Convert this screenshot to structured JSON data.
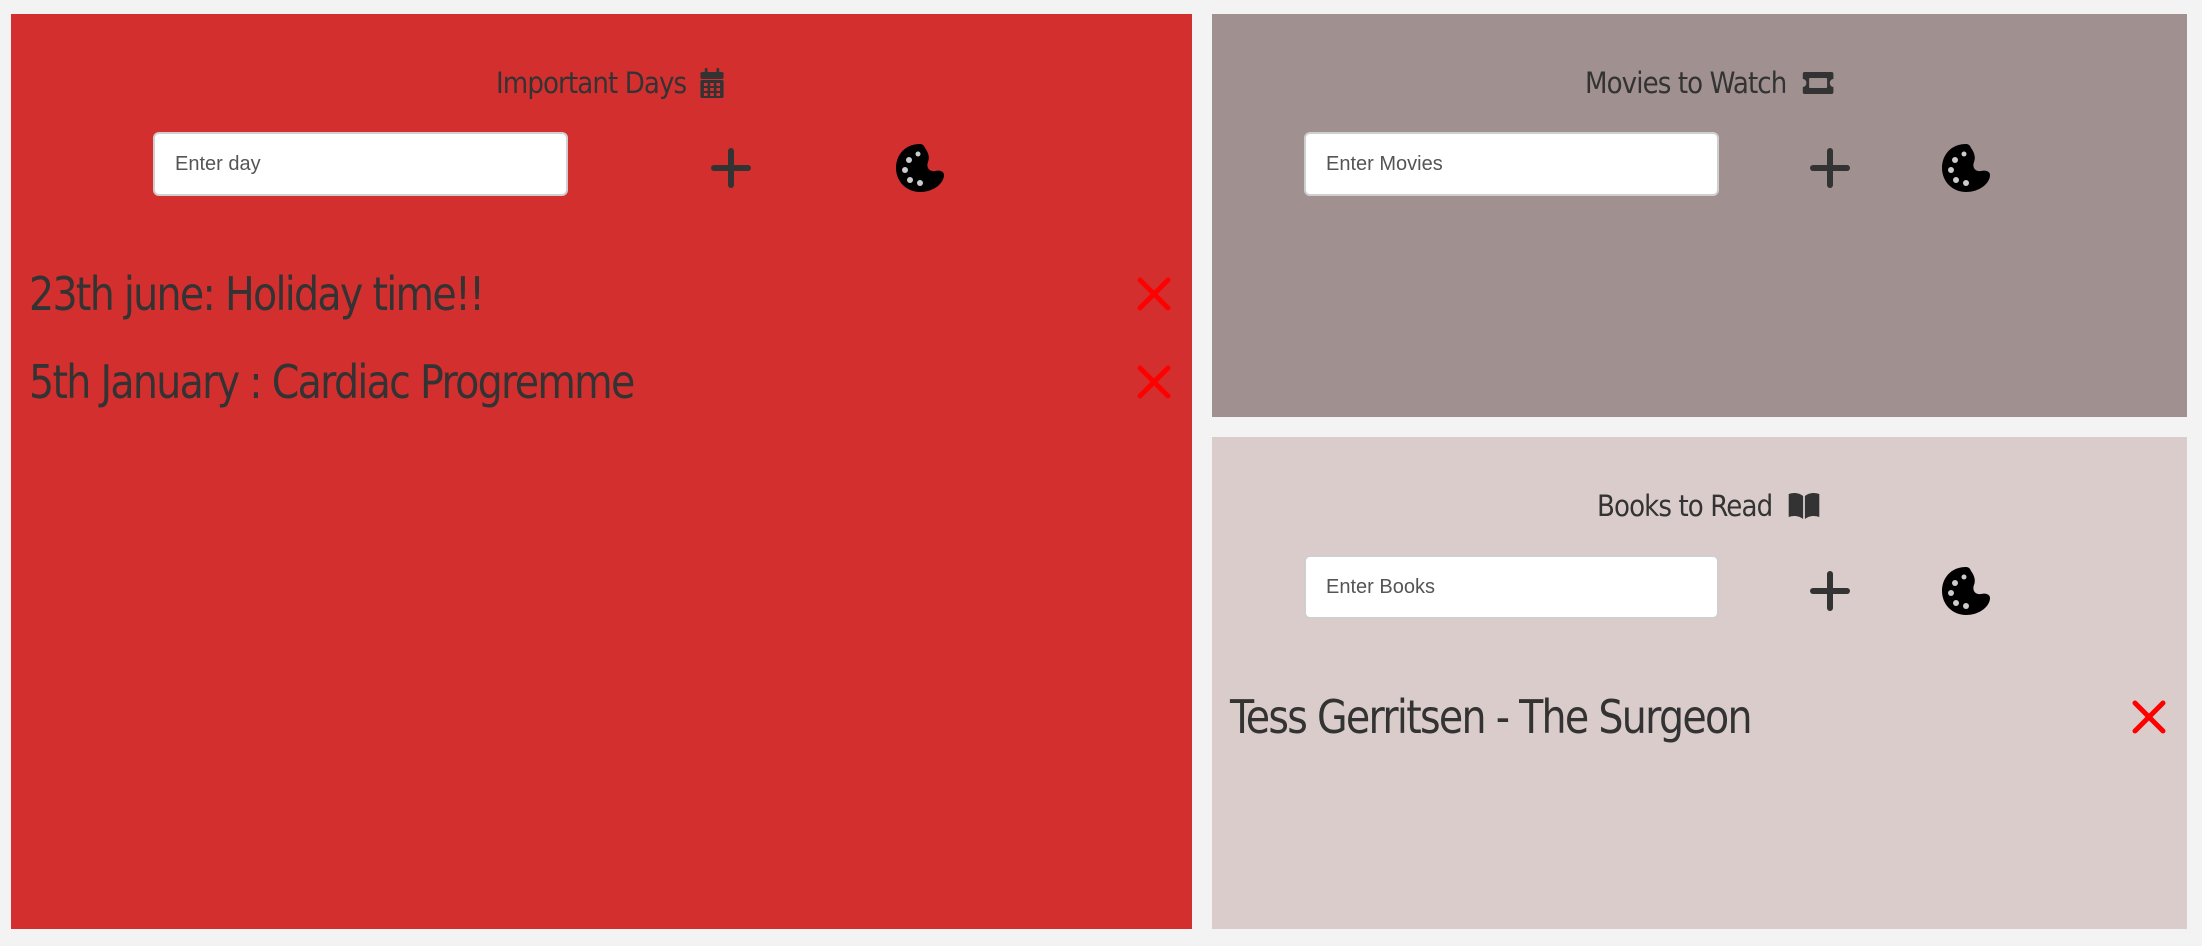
{
  "important_days": {
    "title": "Important Days",
    "title_icon": "calendar-icon",
    "input_placeholder": "Enter day",
    "add_icon": "plus-icon",
    "palette_icon": "palette-icon",
    "background": "#d32f2f",
    "items": [
      {
        "text": "23th june: Holiday time!!"
      },
      {
        "text": "5th January : Cardiac Progremme"
      }
    ]
  },
  "movies": {
    "title": "Movies to Watch",
    "title_icon": "ticket-icon",
    "input_placeholder": "Enter Movies",
    "add_icon": "plus-icon",
    "palette_icon": "palette-icon",
    "background": "#a09090",
    "items": []
  },
  "books": {
    "title": "Books to Read",
    "title_icon": "book-open-icon",
    "input_placeholder": "Enter Books",
    "add_icon": "plus-icon",
    "palette_icon": "palette-icon",
    "background": "#d9cccb",
    "items": [
      {
        "text": "Tess Gerritsen - The Surgeon"
      }
    ]
  },
  "colors": {
    "text": "#333333",
    "delete": "#ff0000",
    "page_background": "#f3f3f3"
  }
}
